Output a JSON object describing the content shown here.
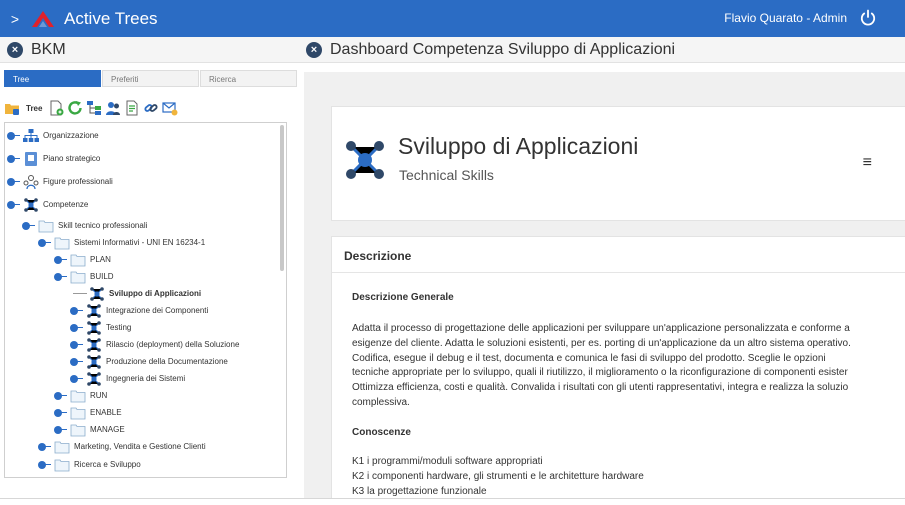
{
  "header": {
    "app_title": "Active Trees",
    "user": "Flavio Quarato - Admin",
    "brand_color": "#2b6cc4"
  },
  "left": {
    "title": "BKM",
    "tabs": [
      "Tree",
      "Preferiti",
      "Ricerca"
    ],
    "toolbar_label": "Tree",
    "tree": [
      {
        "label": "Organizzazione",
        "icon": "org-chart-icon"
      },
      {
        "label": "Piano strategico",
        "icon": "plan-icon"
      },
      {
        "label": "Figure professionali",
        "icon": "people-icon"
      },
      {
        "label": "Competenze",
        "icon": "network-icon"
      },
      {
        "label": "Skill tecnico professionali",
        "icon": "folder-icon"
      },
      {
        "label": "Sistemi Informativi - UNI EN 16234-1",
        "icon": "folder-icon"
      },
      {
        "label": "PLAN",
        "icon": "folder-icon"
      },
      {
        "label": "BUILD",
        "icon": "folder-icon"
      },
      {
        "label": "Sviluppo di Applicazioni",
        "icon": "network-icon",
        "selected": true
      },
      {
        "label": "Integrazione dei Componenti",
        "icon": "network-icon"
      },
      {
        "label": "Testing",
        "icon": "network-icon"
      },
      {
        "label": "Rilascio (deployment) della Soluzione",
        "icon": "network-icon"
      },
      {
        "label": "Produzione della Documentazione",
        "icon": "network-icon"
      },
      {
        "label": "Ingegneria dei Sistemi",
        "icon": "network-icon"
      },
      {
        "label": "RUN",
        "icon": "folder-icon"
      },
      {
        "label": "ENABLE",
        "icon": "folder-icon"
      },
      {
        "label": "MANAGE",
        "icon": "folder-icon"
      },
      {
        "label": "Marketing, Vendita e Gestione Clienti",
        "icon": "folder-icon"
      },
      {
        "label": "Ricerca e Sviluppo",
        "icon": "folder-icon"
      }
    ]
  },
  "right": {
    "title": "Dashboard Competenza Sviluppo di Applicazioni",
    "card_title": "Sviluppo di Applicazioni",
    "card_subtitle": "Technical Skills",
    "menu_glyph": "≡",
    "section_title": "Descrizione",
    "general_title": "Descrizione Generale",
    "general_lines": [
      "Adatta il processo di progettazione delle applicazioni per sviluppare un'applicazione personalizzata e conforme a",
      "esigenze del cliente. Adatta le soluzioni esistenti, per es. porting di un'applicazione da un altro sistema operativo.",
      "Codifica, esegue il debug e il test, documenta e comunica le fasi di sviluppo del prodotto.  Sceglie le opzioni",
      "tecniche appropriate per lo sviluppo, quali il riutilizzo, il miglioramento o la riconfigurazione di componenti esister",
      "Ottimizza efficienza, costi e qualità. Convalida i risultati con gli utenti rappresentativi, integra e realizza la soluzio",
      "complessiva."
    ],
    "knowledge_title": "Conoscenze",
    "knowledge": [
      "K1 i programmi/moduli software appropriati",
      "K2 i componenti hardware, gli strumenti e le architetture hardware",
      "K3 la progettazione funzionale"
    ]
  }
}
